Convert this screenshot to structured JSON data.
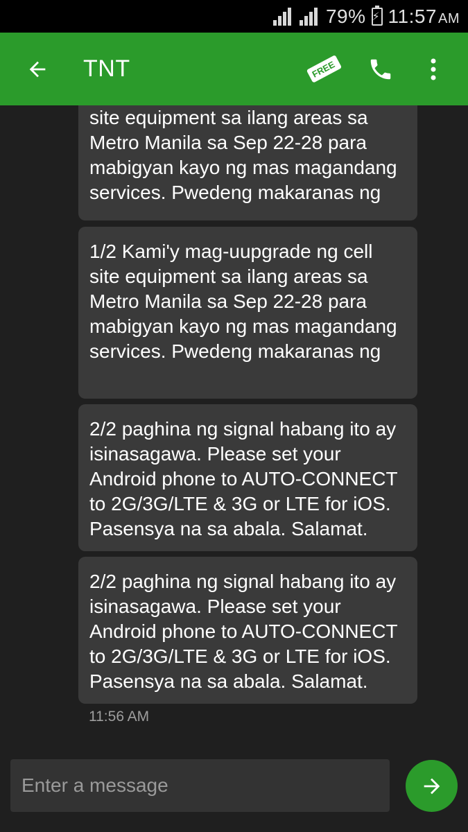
{
  "status_bar": {
    "battery": "79%",
    "time": "11:57",
    "ampm": "AM"
  },
  "header": {
    "title": "TNT",
    "free_badge": "FREE",
    "icons": {
      "back": "arrow-left-icon",
      "free": "free-tag-icon",
      "call": "phone-icon",
      "more": "more-vert-icon"
    }
  },
  "messages": [
    {
      "text": "site equipment sa ilang areas sa Metro Manila sa Sep 22-28 para mabigyan kayo ng mas magandang services. Pwedeng makaranas ng"
    },
    {
      "text": "1/2 Kami'y mag-uupgrade ng cell site equipment sa ilang areas sa Metro Manila sa Sep 22-28 para mabigyan kayo ng mas magandang services. Pwedeng makaranas ng"
    },
    {
      "text": "2/2 paghina ng signal habang ito ay isinasagawa. Please set your Android phone to AUTO-CONNECT to 2G/3G/LTE & 3G or LTE for iOS. Pasensya na sa abala. Salamat."
    },
    {
      "text": "2/2 paghina ng signal habang ito ay isinasagawa. Please set your Android phone to AUTO-CONNECT to 2G/3G/LTE & 3G or LTE for iOS. Pasensya na sa abala. Salamat."
    }
  ],
  "timestamp": "11:56 AM",
  "composer": {
    "placeholder": "Enter a message",
    "value": ""
  },
  "colors": {
    "accent": "#2b9b2b",
    "bubble": "#3a3a3a",
    "background": "#1f1f1f"
  }
}
